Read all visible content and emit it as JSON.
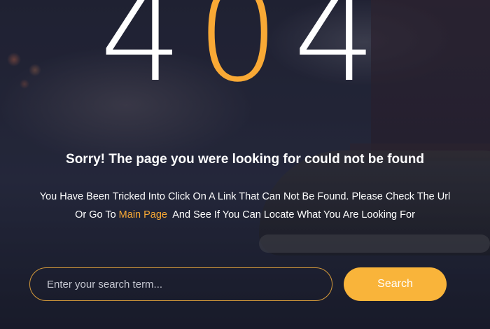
{
  "error_code": {
    "first": "4",
    "middle": "0",
    "last": "4"
  },
  "headline": "Sorry! The page you were looking for could not be found",
  "message": {
    "before_link": "You Have Been Tricked Into Click On A Link That Can Not Be Found. Please Check The Url Or Go To ",
    "link_label": "Main Page",
    "after_link": "  And See If You Can Locate What You Are Looking For"
  },
  "search": {
    "placeholder": "Enter your search term...",
    "value": "",
    "button_label": "Search"
  },
  "colors": {
    "accent": "#f9a935",
    "text": "#ffffff"
  }
}
